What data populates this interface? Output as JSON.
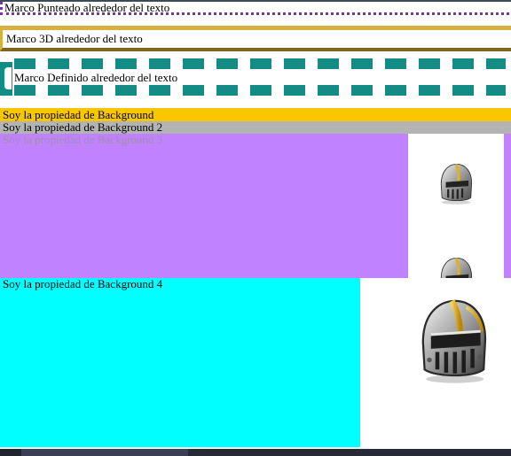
{
  "boxes": {
    "dotted": "Marco Punteado alrededor del texto",
    "ridge": "Marco 3D alrededor del texto",
    "image_border": "Marco Definido alrededor del texto",
    "bg1": "Soy la propiedad de Background",
    "bg2": "Soy la propiedad de Background 2",
    "bg3": "Soy la propiedad de Background 3",
    "bg4": "Soy la propiedad de Background 4"
  },
  "colors": {
    "dotted_border": "#7a32a8",
    "ridge_light": "#d7b042",
    "ridge_dark": "#7f6521",
    "image_border": "#128c85",
    "bg1": "#f7c800",
    "bg2": "#b3b3b3",
    "bg3": "#c082ff",
    "bg4": "#00ffff"
  },
  "images": {
    "helmet": "knight-helmet-icon"
  }
}
